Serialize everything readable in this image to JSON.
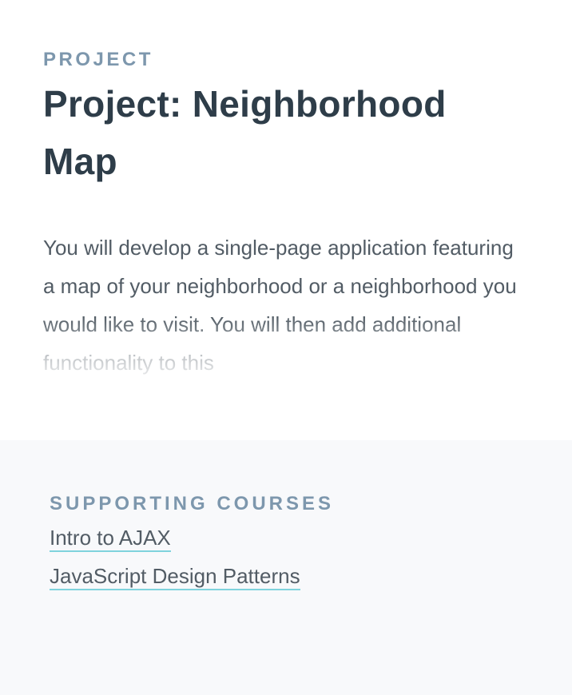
{
  "project": {
    "eyebrow": "PROJECT",
    "title_line1": "Project: Neighborhood",
    "title_line2": "Map",
    "description": "You will develop a single-page application featuring a map of your neighborhood or a neighborhood you would like to visit. You will then add additional functionality to this"
  },
  "supporting": {
    "heading": "SUPPORTING COURSES",
    "courses": [
      {
        "label": "Intro to AJAX"
      },
      {
        "label": "JavaScript Design Patterns"
      }
    ]
  },
  "colors": {
    "eyebrow": "#7d97ad",
    "title": "#2e3d49",
    "body_text": "#525c65",
    "link_underline": "#7fd3dd",
    "bottom_background": "#f8f9fb"
  }
}
